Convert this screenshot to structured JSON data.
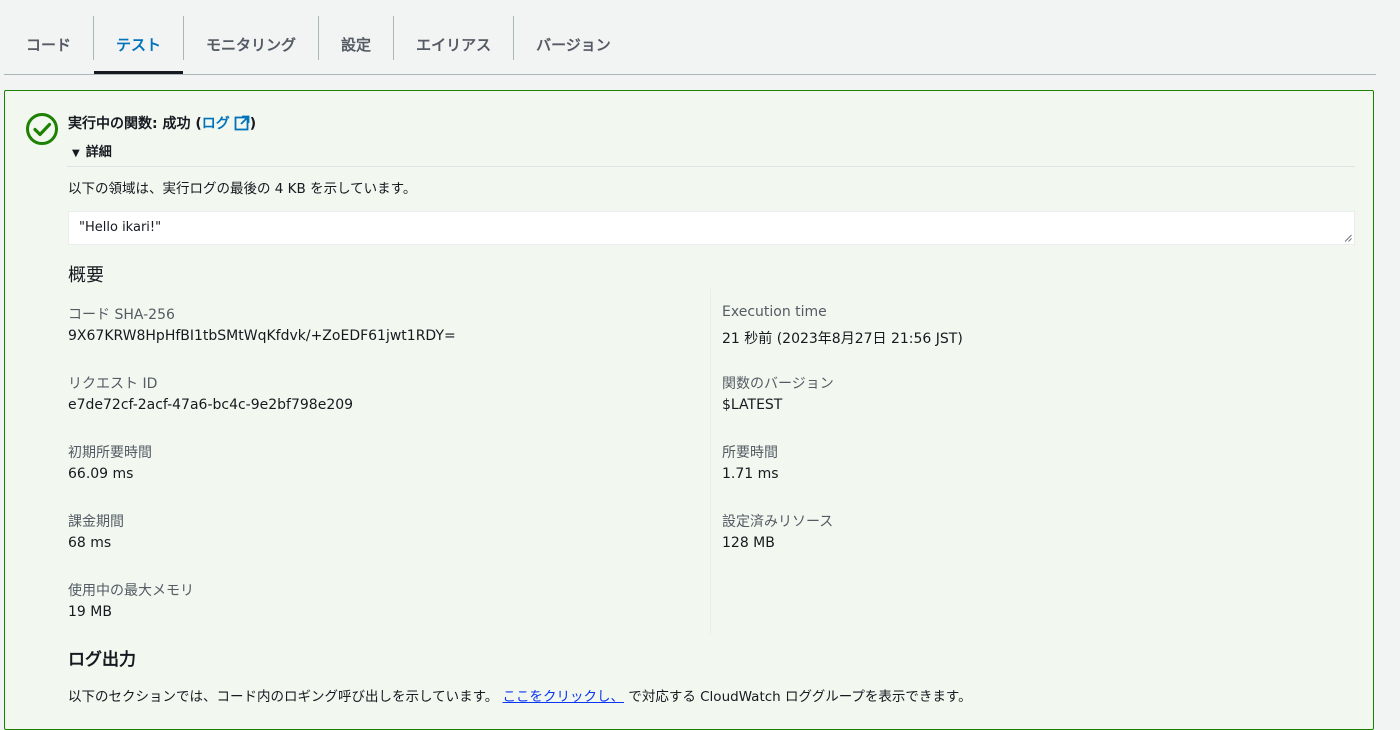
{
  "tabs": [
    {
      "label": "コード",
      "active": false
    },
    {
      "label": "テスト",
      "active": true
    },
    {
      "label": "モニタリング",
      "active": false
    },
    {
      "label": "設定",
      "active": false
    },
    {
      "label": "エイリアス",
      "active": false
    },
    {
      "label": "バージョン",
      "active": false
    }
  ],
  "result": {
    "status_prefix": "実行中の関数: 成功 (",
    "log_link": "ログ",
    "status_suffix": ")",
    "details_label": "詳細",
    "description": "以下の領域は、実行ログの最後の 4 KB を示しています。",
    "output_value": "\"Hello ikari!\""
  },
  "summary": {
    "heading": "概要",
    "items": [
      {
        "label": "コード SHA-256",
        "value": "9X67KRW8HpHfBI1tbSMtWqKfdvk/+ZoEDF61jwt1RDY="
      },
      {
        "label": "Execution time",
        "value": "21 秒前 (2023年8月27日 21:56 JST)"
      },
      {
        "label": "リクエスト ID",
        "value": "e7de72cf-2acf-47a6-bc4c-9e2bf798e209"
      },
      {
        "label": "関数のバージョン",
        "value": "$LATEST"
      },
      {
        "label": "初期所要時間",
        "value": "66.09 ms"
      },
      {
        "label": "所要時間",
        "value": "1.71 ms"
      },
      {
        "label": "課金期間",
        "value": "68 ms"
      },
      {
        "label": "設定済みリソース",
        "value": "128 MB"
      },
      {
        "label": "使用中の最大メモリ",
        "value": "19 MB"
      }
    ]
  },
  "log_output": {
    "heading": "ログ出力",
    "text_before": "以下のセクションでは、コード内のロギング呼び出しを示しています。",
    "link": "ここをクリックし、",
    "text_after": "で対応する CloudWatch ロググループを表示できます。"
  },
  "colors": {
    "success": "#1d8102",
    "link": "#0073bb",
    "panel_bg": "#f2f8f0"
  }
}
